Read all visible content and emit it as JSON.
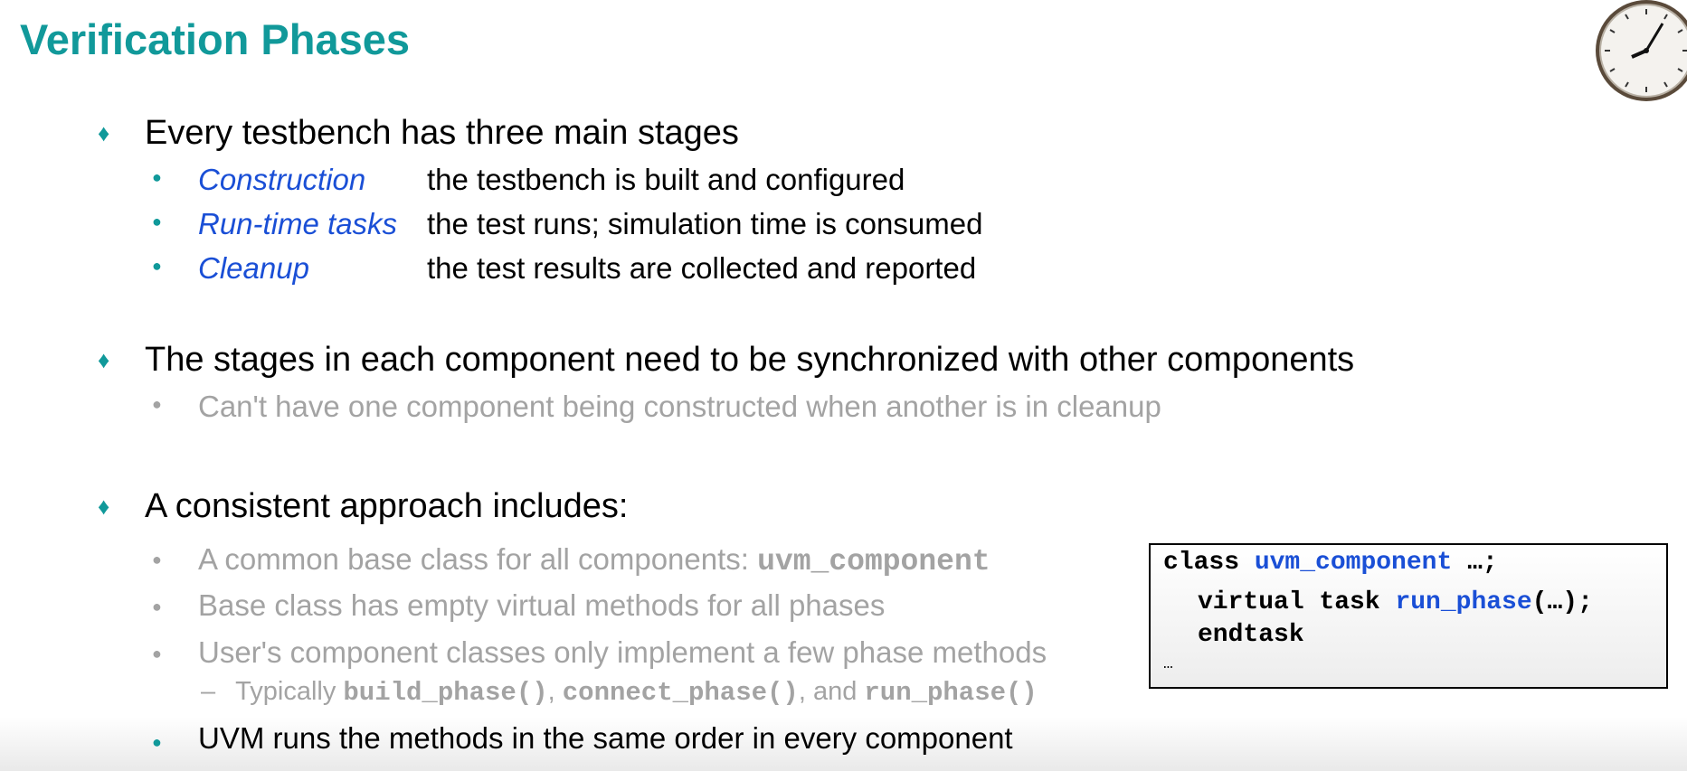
{
  "title": "Verification Phases",
  "sections": [
    {
      "heading": "Every testbench has three main stages",
      "items": [
        {
          "term": "Construction",
          "desc": "the testbench is built and configured"
        },
        {
          "term": "Run-time tasks",
          "desc": "the test runs; simulation time is consumed"
        },
        {
          "term": "Cleanup",
          "desc": "the test results are collected and reported"
        }
      ]
    },
    {
      "heading": "The stages in each component need to be synchronized with other components",
      "items": [
        {
          "text": "Can't have one component being constructed when another is in cleanup"
        }
      ]
    },
    {
      "heading": "A consistent approach includes:",
      "items": [
        {
          "text": "A common base class for all components: ",
          "code": "uvm_component"
        },
        {
          "text": "Base class has empty virtual methods for all phases"
        },
        {
          "text": "User's component classes only implement a few phase methods"
        },
        {
          "text": "UVM runs the methods in the same order in every component"
        }
      ],
      "sub_item": {
        "dash": "–",
        "prefix": "Typically ",
        "code1": "build_phase()",
        "sep1": ", ",
        "code2": "connect_phase()",
        "sep2": ", and ",
        "code3": "run_phase()"
      }
    }
  ],
  "code_box": {
    "line1_kw": "class ",
    "line1_name": "uvm_component",
    "line1_rest": " …;",
    "line2_kw": "virtual task ",
    "line2_name": "run_phase",
    "line2_rest": "(…);",
    "line3": "endtask",
    "line4": "…"
  },
  "glyphs": {
    "diamond": "♦",
    "dot": "●"
  },
  "colors": {
    "title": "#11999a",
    "accent": "#10999a",
    "term": "#1a4fd6",
    "muted": "#a3a3a3"
  }
}
